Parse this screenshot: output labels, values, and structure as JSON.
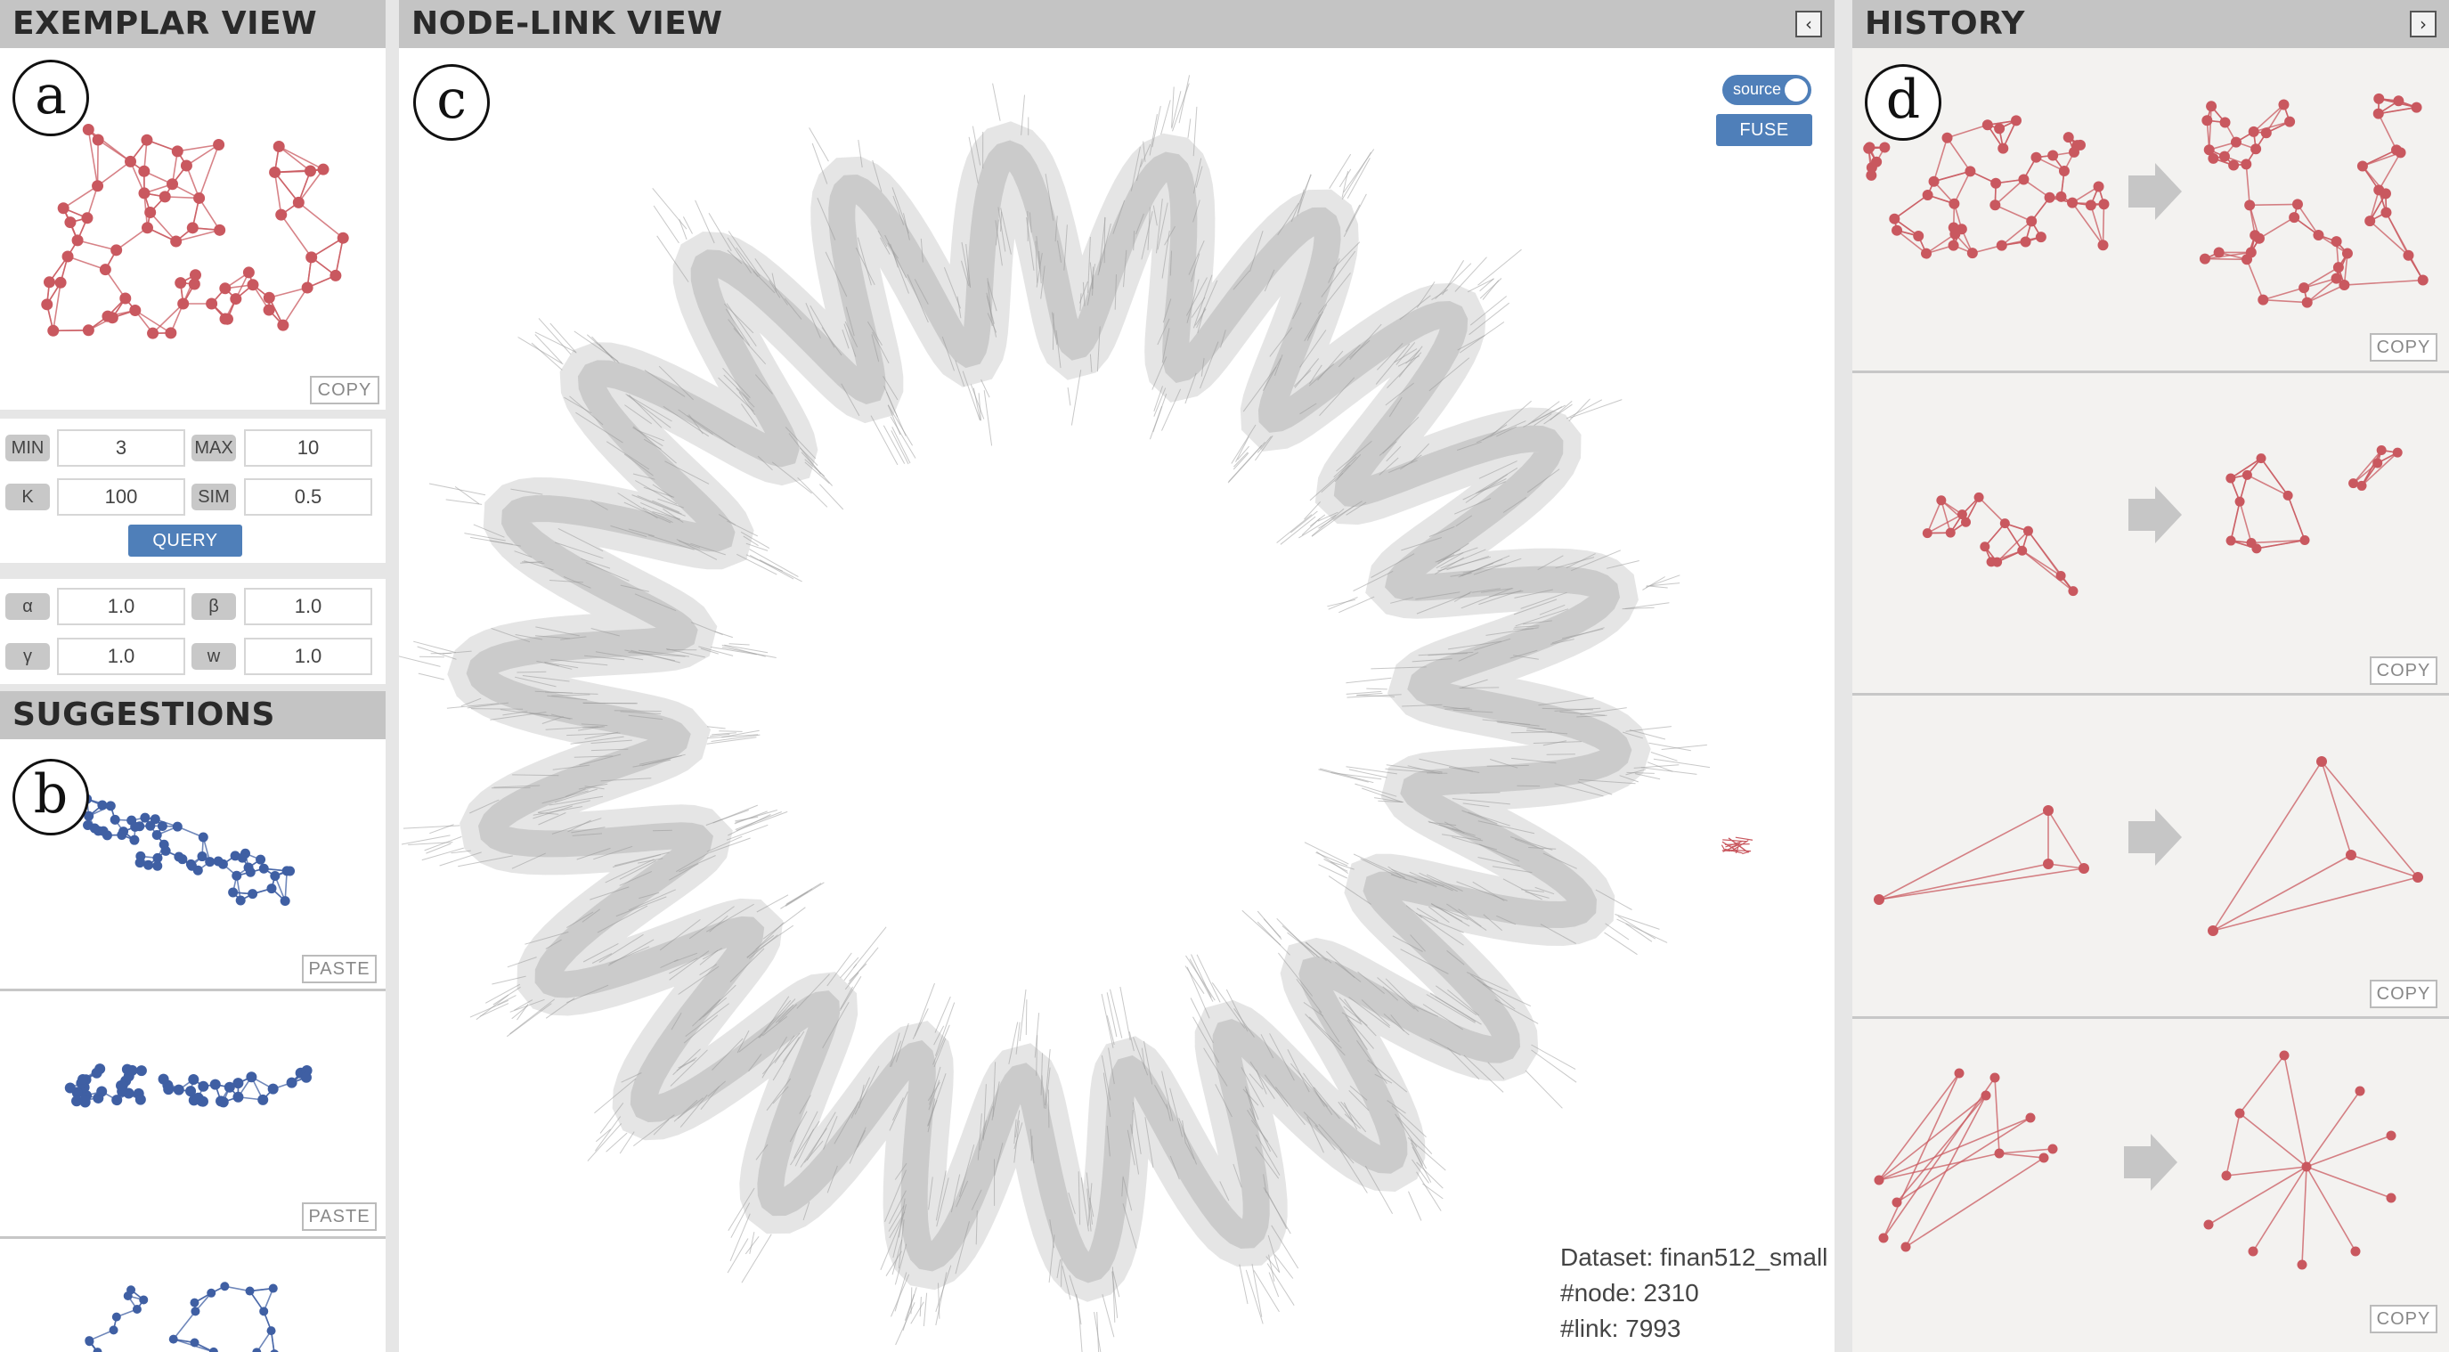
{
  "exemplar": {
    "title": "EXEMPLAR VIEW",
    "badge": "a",
    "copy_label": "COPY"
  },
  "query_params": {
    "min_label": "MIN",
    "min_value": "3",
    "max_label": "MAX",
    "max_value": "10",
    "k_label": "K",
    "k_value": "100",
    "sim_label": "SIM",
    "sim_value": "0.5",
    "query_label": "QUERY"
  },
  "weights": {
    "alpha_label": "α",
    "alpha_value": "1.0",
    "beta_label": "β",
    "beta_value": "1.0",
    "gamma_label": "γ",
    "gamma_value": "1.0",
    "w_label": "w",
    "w_value": "1.0"
  },
  "suggestions": {
    "title": "SUGGESTIONS",
    "badge": "b",
    "paste_label": "PASTE"
  },
  "nodelink": {
    "title": "NODE-LINK VIEW",
    "badge": "c",
    "collapse_icon": "chevron-left-icon",
    "toggle_label": "source",
    "fuse_label": "FUSE",
    "dataset_line": "Dataset: finan512_small",
    "node_line": "#node: 2310",
    "link_line": "#link: 7993"
  },
  "history": {
    "title": "HISTORY",
    "badge": "d",
    "collapse_icon": "chevron-right-icon",
    "copy_label": "COPY"
  },
  "colors": {
    "exemplar_red": "#c9585f",
    "suggestion_blue": "#3f5fa3",
    "graph_gray": "#9a9a9a",
    "accent_blue": "#4f7fb9"
  }
}
